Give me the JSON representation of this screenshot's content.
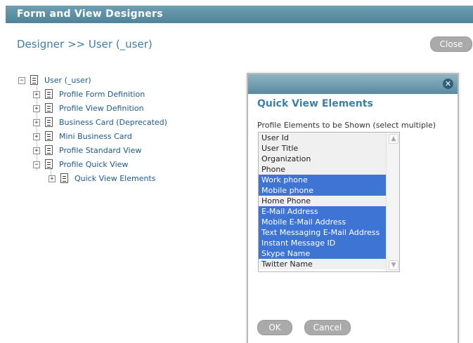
{
  "window": {
    "title": "Form and View Designers"
  },
  "header": {
    "breadcrumb": "Designer >> User (_user)",
    "close_label": "Close"
  },
  "tree": {
    "root": "User (_user)",
    "children": [
      "Profile Form Definition",
      "Profile View Definition",
      "Business Card (Deprecated)",
      "Mini Business Card",
      "Profile Standard View",
      "Profile Quick View"
    ],
    "grandchild": "Quick View Elements"
  },
  "dialog": {
    "close_glyph": "✕",
    "title": "Quick View Elements",
    "list_label": "Profile Elements to be Shown (select multiple)",
    "options": [
      {
        "label": "User Id",
        "selected": false
      },
      {
        "label": "User Title",
        "selected": false
      },
      {
        "label": "Organization",
        "selected": false
      },
      {
        "label": "Phone",
        "selected": false
      },
      {
        "label": "Work phone",
        "selected": true
      },
      {
        "label": "Mobile phone",
        "selected": true
      },
      {
        "label": "Home Phone",
        "selected": false
      },
      {
        "label": "E-Mail Address",
        "selected": true
      },
      {
        "label": "Mobile E-Mail Address",
        "selected": true
      },
      {
        "label": "Text Messaging E-Mail Address",
        "selected": true
      },
      {
        "label": "Instant Message ID",
        "selected": true
      },
      {
        "label": "Skype Name",
        "selected": true
      },
      {
        "label": "Twitter Name",
        "selected": false
      }
    ],
    "ok_label": "OK",
    "cancel_label": "Cancel"
  }
}
